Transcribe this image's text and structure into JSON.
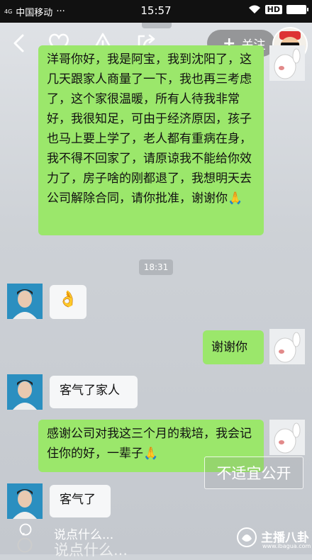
{
  "status_bar": {
    "network": "4G",
    "carrier": "中国移动",
    "dots": "···",
    "time": "15:57",
    "hd": "HD"
  },
  "top_bar": {
    "follow_plus": "+",
    "follow_label": "关注"
  },
  "messages": [
    {
      "side": "right",
      "type": "text",
      "text": "洋哥你好，我是阿宝，我到沈阳了，这几天跟家人商量了一下，我也再三考虑了，这个家很温暖，所有人待我非常好，我很知足，可由于经济原因，孩子也马上要上学了，老人都有重病在身，我不得不回家了，请原谅我不能给你效力了，房子啥的刚都退了，我想明天去公司解除合同，请你批准，谢谢你🙏"
    },
    {
      "type": "timestamp",
      "text": "18:31"
    },
    {
      "side": "left",
      "type": "emoji",
      "text": "👌"
    },
    {
      "side": "right",
      "type": "text",
      "text": "谢谢你"
    },
    {
      "side": "left",
      "type": "text",
      "text": "客气了家人"
    },
    {
      "side": "right",
      "type": "text",
      "text": "感谢公司对我这三个月的栽培，我会记住你的好，一辈子🙏"
    },
    {
      "side": "left",
      "type": "text",
      "text": "客气了"
    }
  ],
  "overlay": {
    "not_public": "不适宜公开"
  },
  "input_bar": {
    "placeholder": "说点什么...",
    "placeholder_echo": "说点什么..."
  },
  "watermark": {
    "brand": "主播八卦",
    "url": "www.ibagua.com"
  },
  "colors": {
    "bubble_green": "#9be76b",
    "bubble_white": "#f6f7f8",
    "chat_bg": "#d4d8dc"
  }
}
